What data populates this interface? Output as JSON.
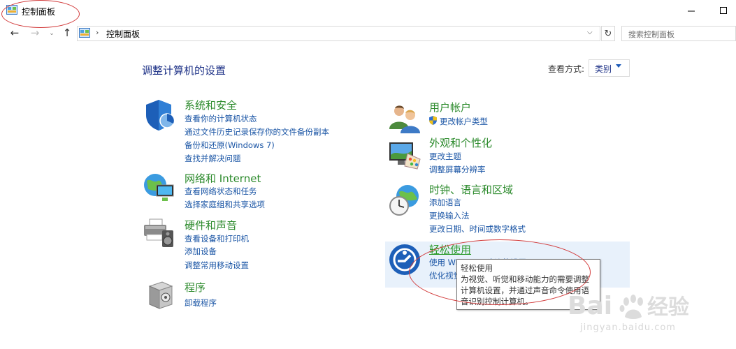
{
  "window": {
    "title": "控制面板"
  },
  "address": {
    "path": "控制面板",
    "search_placeholder": "搜索控制面板"
  },
  "main": {
    "title": "调整计算机的设置",
    "view_label": "查看方式:",
    "view_value": "类别"
  },
  "categories": [
    {
      "title": "系统和安全",
      "icon": "shield-icon",
      "links": [
        "查看你的计算机状态",
        "通过文件历史记录保存你的文件备份副本",
        "备份和还原(Windows 7)",
        "查找并解决问题"
      ]
    },
    {
      "title": "网络和 Internet",
      "icon": "network-globe-icon",
      "links": [
        "查看网络状态和任务",
        "选择家庭组和共享选项"
      ]
    },
    {
      "title": "硬件和声音",
      "icon": "printer-speaker-icon",
      "links": [
        "查看设备和打印机",
        "添加设备",
        "调整常用移动设置"
      ]
    },
    {
      "title": "程序",
      "icon": "programs-box-icon",
      "links": [
        "卸载程序"
      ]
    },
    {
      "title": "用户帐户",
      "icon": "users-icon",
      "links": [
        "更改帐户类型"
      ]
    },
    {
      "title": "外观和个性化",
      "icon": "monitor-palette-icon",
      "links": [
        "更改主题",
        "调整屏幕分辨率"
      ]
    },
    {
      "title": "时钟、语言和区域",
      "icon": "clock-globe-icon",
      "links": [
        "添加语言",
        "更换输入法",
        "更改日期、时间或数字格式"
      ]
    },
    {
      "title": "轻松使用",
      "icon": "ease-of-access-icon",
      "links": [
        "使用 Windows 建议的设置",
        "优化视觉显示"
      ]
    }
  ],
  "tooltip": {
    "lines": [
      "轻松使用",
      "为视觉、听觉和移动能力的需要调整",
      "计算机设置，并通过声音命令使用语",
      "音识别控制计算机。"
    ]
  },
  "watermark": {
    "text": "Bai经验",
    "url": "jingyan.baidu.com"
  },
  "colors": {
    "accent_link": "#1a55a5",
    "category_title": "#2b8a2b",
    "annotation": "#d23c3c"
  }
}
